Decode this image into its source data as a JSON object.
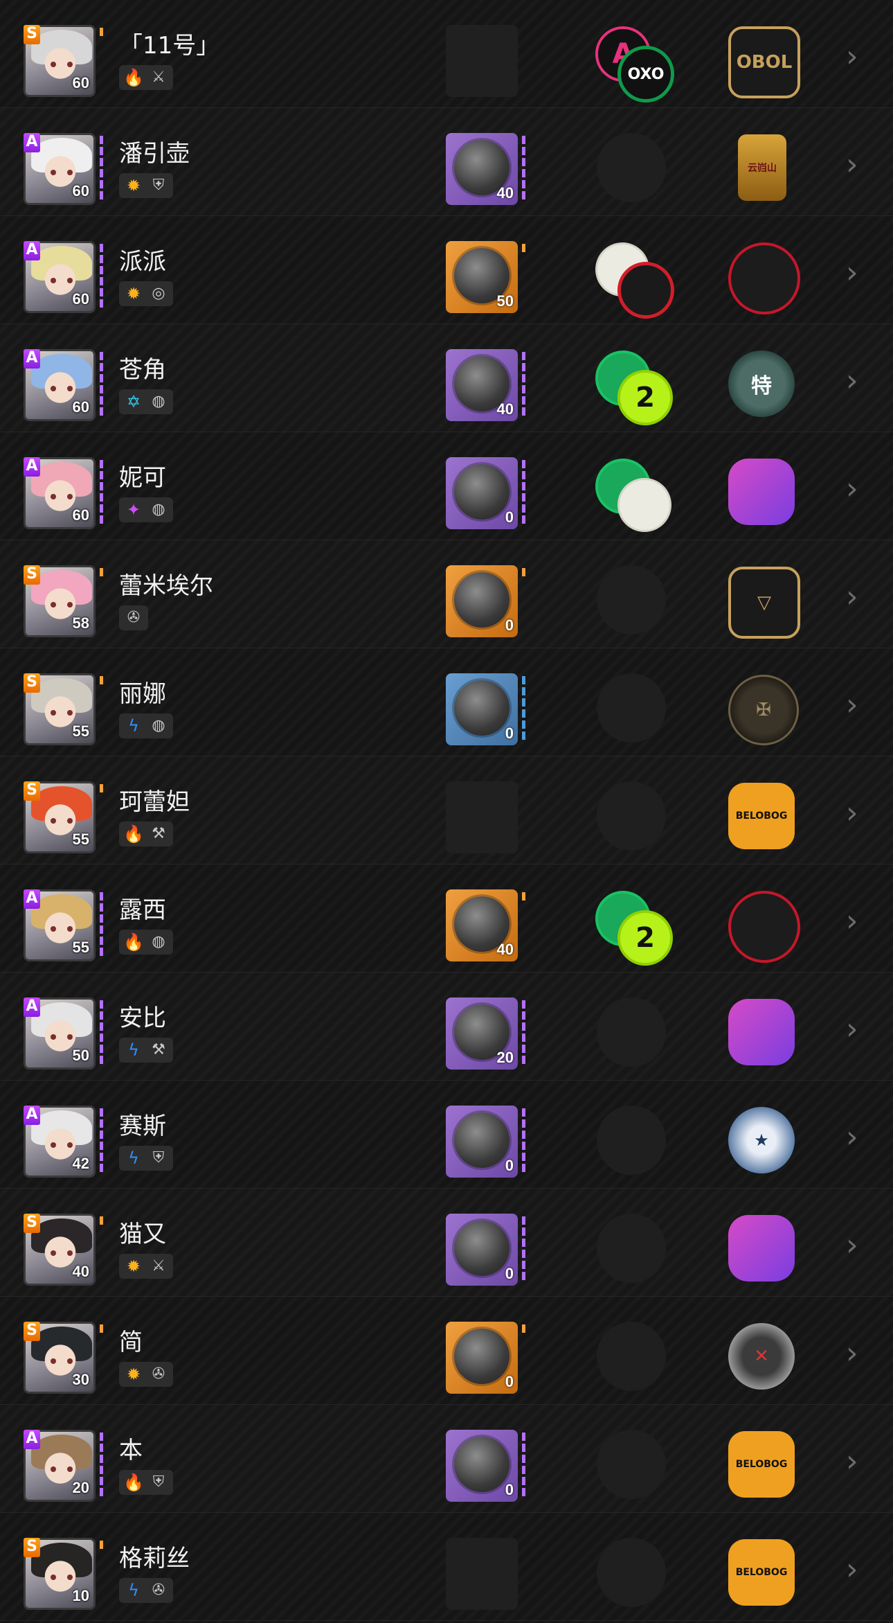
{
  "agents": [
    {
      "rank": "S",
      "name": "「11号」",
      "level": "60",
      "attr_icon": "fire-icon",
      "attr_glyph": "🔥",
      "attr_color": "#ff5a2a",
      "role_icon": "attack-icon",
      "role_glyph": "⚔",
      "engine_level": "",
      "engine_color": "empty",
      "disc_1": "A",
      "disc_1_style": "pink",
      "disc_2": "OXO",
      "disc_2_style": "oxo",
      "faction_icon": "cunning-hares-icon",
      "faction_label": "OBOL",
      "faction_style": "f-obol",
      "hair": "#d7d7d7"
    },
    {
      "rank": "A",
      "name": "潘引壶",
      "level": "60",
      "attr_icon": "physical-icon",
      "attr_glyph": "✹",
      "attr_color": "#ffb21a",
      "role_icon": "defense-icon",
      "role_glyph": "⛨",
      "engine_level": "40",
      "engine_color": "purple",
      "disc_1": "",
      "disc_1_style": "",
      "disc_2": "",
      "disc_2_style": "",
      "faction_icon": "yunkui-summit-icon",
      "faction_label": "云岿山",
      "faction_style": "f-gold",
      "hair": "#efefef"
    },
    {
      "rank": "A",
      "name": "派派",
      "level": "60",
      "attr_icon": "physical-icon",
      "attr_glyph": "✹",
      "attr_color": "#ffb21a",
      "role_icon": "stun-icon",
      "role_glyph": "◎",
      "engine_level": "50",
      "engine_color": "orange",
      "disc_1": "",
      "disc_1_style": "cream",
      "disc_2": "",
      "disc_2_style": "redring",
      "faction_icon": "sons-of-calydon-icon",
      "faction_label": "",
      "faction_style": "f-sons",
      "hair": "#e6dc9c"
    },
    {
      "rank": "A",
      "name": "苍角",
      "level": "60",
      "attr_icon": "ice-icon",
      "attr_glyph": "✡",
      "attr_color": "#37d0f5",
      "role_icon": "support-icon",
      "role_glyph": "◍",
      "engine_level": "40",
      "engine_color": "purple",
      "disc_1": "",
      "disc_1_style": "green",
      "disc_2": "2",
      "disc_2_style": "lime",
      "faction_icon": "hsos6-icon",
      "faction_label": "特",
      "faction_style": "f-hsos",
      "hair": "#8fb6e6"
    },
    {
      "rank": "A",
      "name": "妮可",
      "level": "60",
      "attr_icon": "ether-icon",
      "attr_glyph": "✦",
      "attr_color": "#d04bff",
      "role_icon": "support-icon",
      "role_glyph": "◍",
      "engine_level": "0",
      "engine_color": "purple",
      "disc_1": "",
      "disc_1_style": "green",
      "disc_2": "",
      "disc_2_style": "cream",
      "faction_icon": "cunning-hares-icon",
      "faction_label": "",
      "faction_style": "f-victoria",
      "hair": "#f0a7b6"
    },
    {
      "rank": "S",
      "name": "蕾米埃尔",
      "level": "58",
      "attr_icon": "",
      "attr_glyph": "",
      "attr_color": "#cccccc",
      "role_icon": "anomaly-icon",
      "role_glyph": "✇",
      "engine_level": "0",
      "engine_color": "orange",
      "disc_1": "",
      "disc_1_style": "",
      "disc_2": "",
      "disc_2_style": "",
      "faction_icon": "obol-squad-icon",
      "faction_label": "▽",
      "faction_style": "f-obol",
      "hair": "#f2a6c0"
    },
    {
      "rank": "S",
      "name": "丽娜",
      "level": "55",
      "attr_icon": "electric-icon",
      "attr_glyph": "ϟ",
      "attr_color": "#2f8fff",
      "role_icon": "support-icon",
      "role_glyph": "◍",
      "engine_level": "0",
      "engine_color": "blue",
      "disc_1": "",
      "disc_1_style": "",
      "disc_2": "",
      "disc_2_style": "",
      "faction_icon": "victoria-housekeeping-icon",
      "faction_label": "✠",
      "faction_style": "f-defense",
      "hair": "#cfcac0"
    },
    {
      "rank": "S",
      "name": "珂蕾妲",
      "level": "55",
      "attr_icon": "fire-icon",
      "attr_glyph": "🔥",
      "attr_color": "#ff5a2a",
      "role_icon": "stun-icon",
      "role_glyph": "⚒",
      "engine_level": "",
      "engine_color": "empty",
      "disc_1": "",
      "disc_1_style": "",
      "disc_2": "",
      "disc_2_style": "",
      "faction_icon": "belobog-icon",
      "faction_label": "BELOBOG",
      "faction_style": "f-belobog",
      "hair": "#e5532c"
    },
    {
      "rank": "A",
      "name": "露西",
      "level": "55",
      "attr_icon": "fire-icon",
      "attr_glyph": "🔥",
      "attr_color": "#ff5a2a",
      "role_icon": "support-icon",
      "role_glyph": "◍",
      "engine_level": "40",
      "engine_color": "orange",
      "disc_1": "",
      "disc_1_style": "green",
      "disc_2": "2",
      "disc_2_style": "lime",
      "faction_icon": "sons-of-calydon-icon",
      "faction_label": "",
      "faction_style": "f-sons",
      "hair": "#d8b26a"
    },
    {
      "rank": "A",
      "name": "安比",
      "level": "50",
      "attr_icon": "electric-icon",
      "attr_glyph": "ϟ",
      "attr_color": "#2f8fff",
      "role_icon": "stun-icon",
      "role_glyph": "⚒",
      "engine_level": "20",
      "engine_color": "purple",
      "disc_1": "",
      "disc_1_style": "",
      "disc_2": "",
      "disc_2_style": "",
      "faction_icon": "cunning-hares-icon",
      "faction_label": "",
      "faction_style": "f-victoria",
      "hair": "#e4e4e4"
    },
    {
      "rank": "A",
      "name": "赛斯",
      "level": "42",
      "attr_icon": "electric-icon",
      "attr_glyph": "ϟ",
      "attr_color": "#2f8fff",
      "role_icon": "defense-icon",
      "role_glyph": "⛨",
      "engine_level": "0",
      "engine_color": "purple",
      "disc_1": "",
      "disc_1_style": "",
      "disc_2": "",
      "disc_2_style": "",
      "faction_icon": "criminal-investigation-icon",
      "faction_label": "★",
      "faction_style": "f-police",
      "hair": "#e7e7e7"
    },
    {
      "rank": "S",
      "name": "猫又",
      "level": "40",
      "attr_icon": "physical-icon",
      "attr_glyph": "✹",
      "attr_color": "#ffb21a",
      "role_icon": "attack-icon",
      "role_glyph": "⚔",
      "engine_level": "0",
      "engine_color": "purple",
      "disc_1": "",
      "disc_1_style": "",
      "disc_2": "",
      "disc_2_style": "",
      "faction_icon": "cunning-hares-icon",
      "faction_label": "",
      "faction_style": "f-victoria",
      "hair": "#2b2628"
    },
    {
      "rank": "S",
      "name": "简",
      "level": "30",
      "attr_icon": "physical-icon",
      "attr_glyph": "✹",
      "attr_color": "#ffb21a",
      "role_icon": "anomaly-icon",
      "role_glyph": "✇",
      "engine_level": "0",
      "engine_color": "orange",
      "disc_1": "",
      "disc_1_style": "",
      "disc_2": "",
      "disc_2_style": "",
      "faction_icon": "sixth-street-icon",
      "faction_label": "✕",
      "faction_style": "f-sixth",
      "hair": "#262a2d"
    },
    {
      "rank": "A",
      "name": "本",
      "level": "20",
      "attr_icon": "fire-icon",
      "attr_glyph": "🔥",
      "attr_color": "#ff5a2a",
      "role_icon": "defense-icon",
      "role_glyph": "⛨",
      "engine_level": "0",
      "engine_color": "purple",
      "disc_1": "",
      "disc_1_style": "",
      "disc_2": "",
      "disc_2_style": "",
      "faction_icon": "belobog-icon",
      "faction_label": "BELOBOG",
      "faction_style": "f-belobog",
      "hair": "#9b7a58"
    },
    {
      "rank": "S",
      "name": "格莉丝",
      "level": "10",
      "attr_icon": "electric-icon",
      "attr_glyph": "ϟ",
      "attr_color": "#2f8fff",
      "role_icon": "anomaly-icon",
      "role_glyph": "✇",
      "engine_level": "",
      "engine_color": "empty",
      "disc_1": "",
      "disc_1_style": "",
      "disc_2": "",
      "disc_2_style": "",
      "faction_icon": "belobog-icon",
      "faction_label": "BELOBOG",
      "faction_style": "f-belobog",
      "hair": "#272424"
    }
  ],
  "chevron_glyph": "›"
}
